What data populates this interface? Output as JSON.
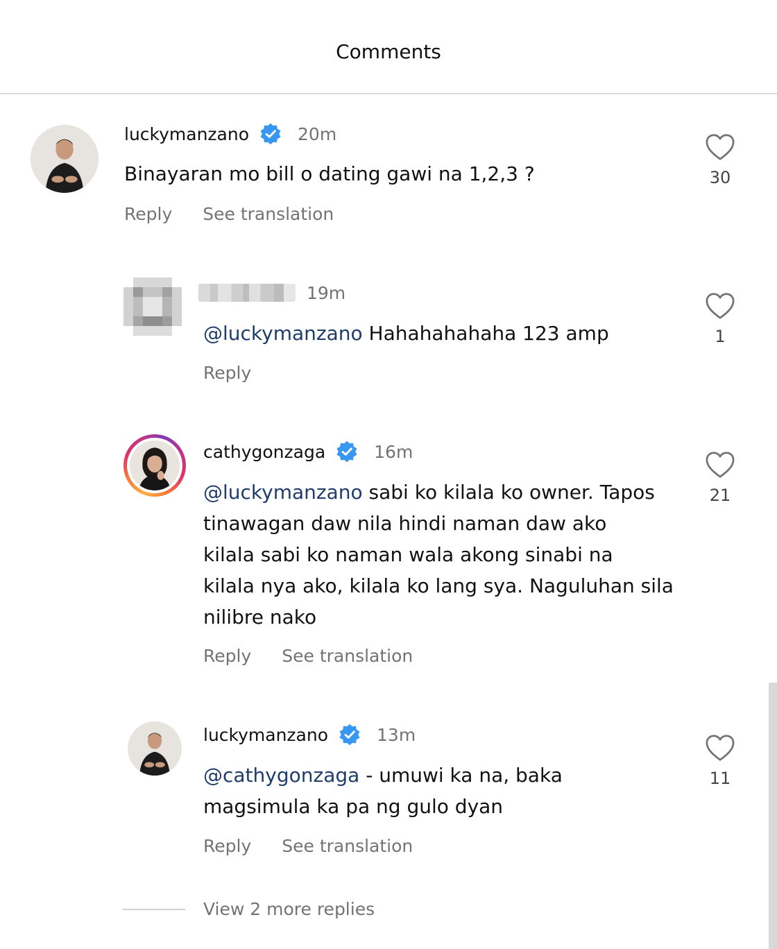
{
  "header": {
    "title": "Comments"
  },
  "comments": [
    {
      "username": "luckymanzano",
      "verified": true,
      "time": "20m",
      "mention": "",
      "text": "Binayaran mo bill o dating gawi na 1,2,3 ?",
      "reply_label": "Reply",
      "translate_label": "See translation",
      "likes": "30"
    },
    {
      "username": "",
      "verified": false,
      "time": "19m",
      "mention": "@luckymanzano",
      "text": " Hahahahahaha 123 amp",
      "reply_label": "Reply",
      "translate_label": "",
      "likes": "1"
    },
    {
      "username": "cathygonzaga",
      "verified": true,
      "time": "16m",
      "mention": "@luckymanzano",
      "text": " sabi ko kilala ko owner. Tapos\ntinawagan daw nila hindi naman daw ako\nkilala sabi ko naman wala akong sinabi na\nkilala nya ako, kilala ko lang sya. Naguluhan sila\nnilibre nako",
      "reply_label": "Reply",
      "translate_label": "See translation",
      "likes": "21"
    },
    {
      "username": "luckymanzano",
      "verified": true,
      "time": "13m",
      "mention": "@cathygonzaga",
      "text": " - umuwi ka na, baka\nmagsimula ka pa ng gulo dyan",
      "reply_label": "Reply",
      "translate_label": "See translation",
      "likes": "11"
    }
  ],
  "view_more_replies": "View 2 more replies",
  "icons": {
    "verified": "verified-badge-icon",
    "like": "heart-outline-icon"
  },
  "colors": {
    "verified": "#3897f0",
    "mention": "#1f3d6b",
    "secondary_text": "#737373"
  }
}
